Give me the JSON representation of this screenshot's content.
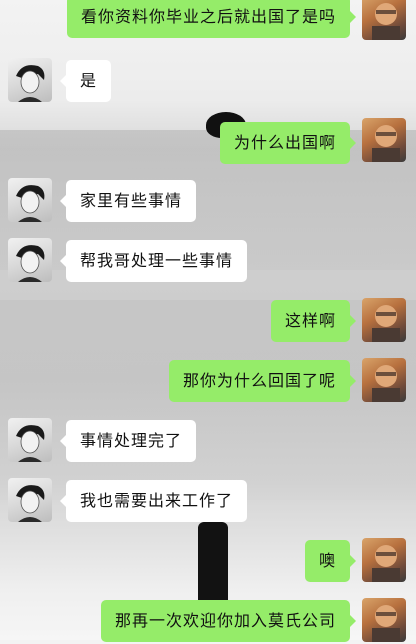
{
  "messages": [
    {
      "side": "right",
      "text": "看你资料你毕业之后就出国了是吗"
    },
    {
      "side": "left",
      "text": "是"
    },
    {
      "side": "right",
      "text": "为什么出国啊"
    },
    {
      "side": "left",
      "text": "家里有些事情"
    },
    {
      "side": "left",
      "text": "帮我哥处理一些事情"
    },
    {
      "side": "right",
      "text": "这样啊"
    },
    {
      "side": "right",
      "text": "那你为什么回国了呢"
    },
    {
      "side": "left",
      "text": "事情处理完了"
    },
    {
      "side": "left",
      "text": "我也需要出来工作了"
    },
    {
      "side": "right",
      "text": "噢"
    },
    {
      "side": "right",
      "text": "那再一次欢迎你加入莫氏公司"
    }
  ],
  "colors": {
    "sent_bubble": "#95ec69",
    "received_bubble": "#ffffff"
  },
  "avatars": {
    "sender": "avatar-right-icon",
    "receiver": "avatar-left-icon"
  }
}
